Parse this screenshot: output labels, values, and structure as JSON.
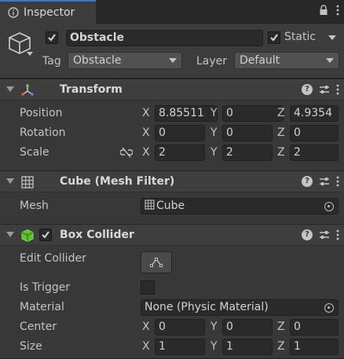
{
  "window": {
    "tab_title": "Inspector"
  },
  "header": {
    "object_name": "Obstacle",
    "static_label": "Static",
    "tag_label": "Tag",
    "tag_value": "Obstacle",
    "layer_label": "Layer",
    "layer_value": "Default"
  },
  "transform": {
    "title": "Transform",
    "position": {
      "label": "Position",
      "x": "8.85511",
      "y": "0",
      "z": "4.9354"
    },
    "rotation": {
      "label": "Rotation",
      "x": "0",
      "y": "0",
      "z": "0"
    },
    "scale": {
      "label": "Scale",
      "x": "2",
      "y": "2",
      "z": "2"
    }
  },
  "mesh_filter": {
    "title": "Cube (Mesh Filter)",
    "mesh_label": "Mesh",
    "mesh_value": "Cube"
  },
  "box_collider": {
    "title": "Box Collider",
    "edit_collider_label": "Edit Collider",
    "is_trigger_label": "Is Trigger",
    "material_label": "Material",
    "material_value": "None (Physic Material)",
    "center": {
      "label": "Center",
      "x": "0",
      "y": "0",
      "z": "0"
    },
    "size": {
      "label": "Size",
      "x": "1",
      "y": "1",
      "z": "1"
    }
  },
  "axes": {
    "x": "X",
    "y": "Y",
    "z": "Z"
  },
  "colors": {
    "accent": "#3a79bb",
    "background": "#383838",
    "field": "#2a2a2a",
    "collider_icon": "#6fcf3a"
  }
}
